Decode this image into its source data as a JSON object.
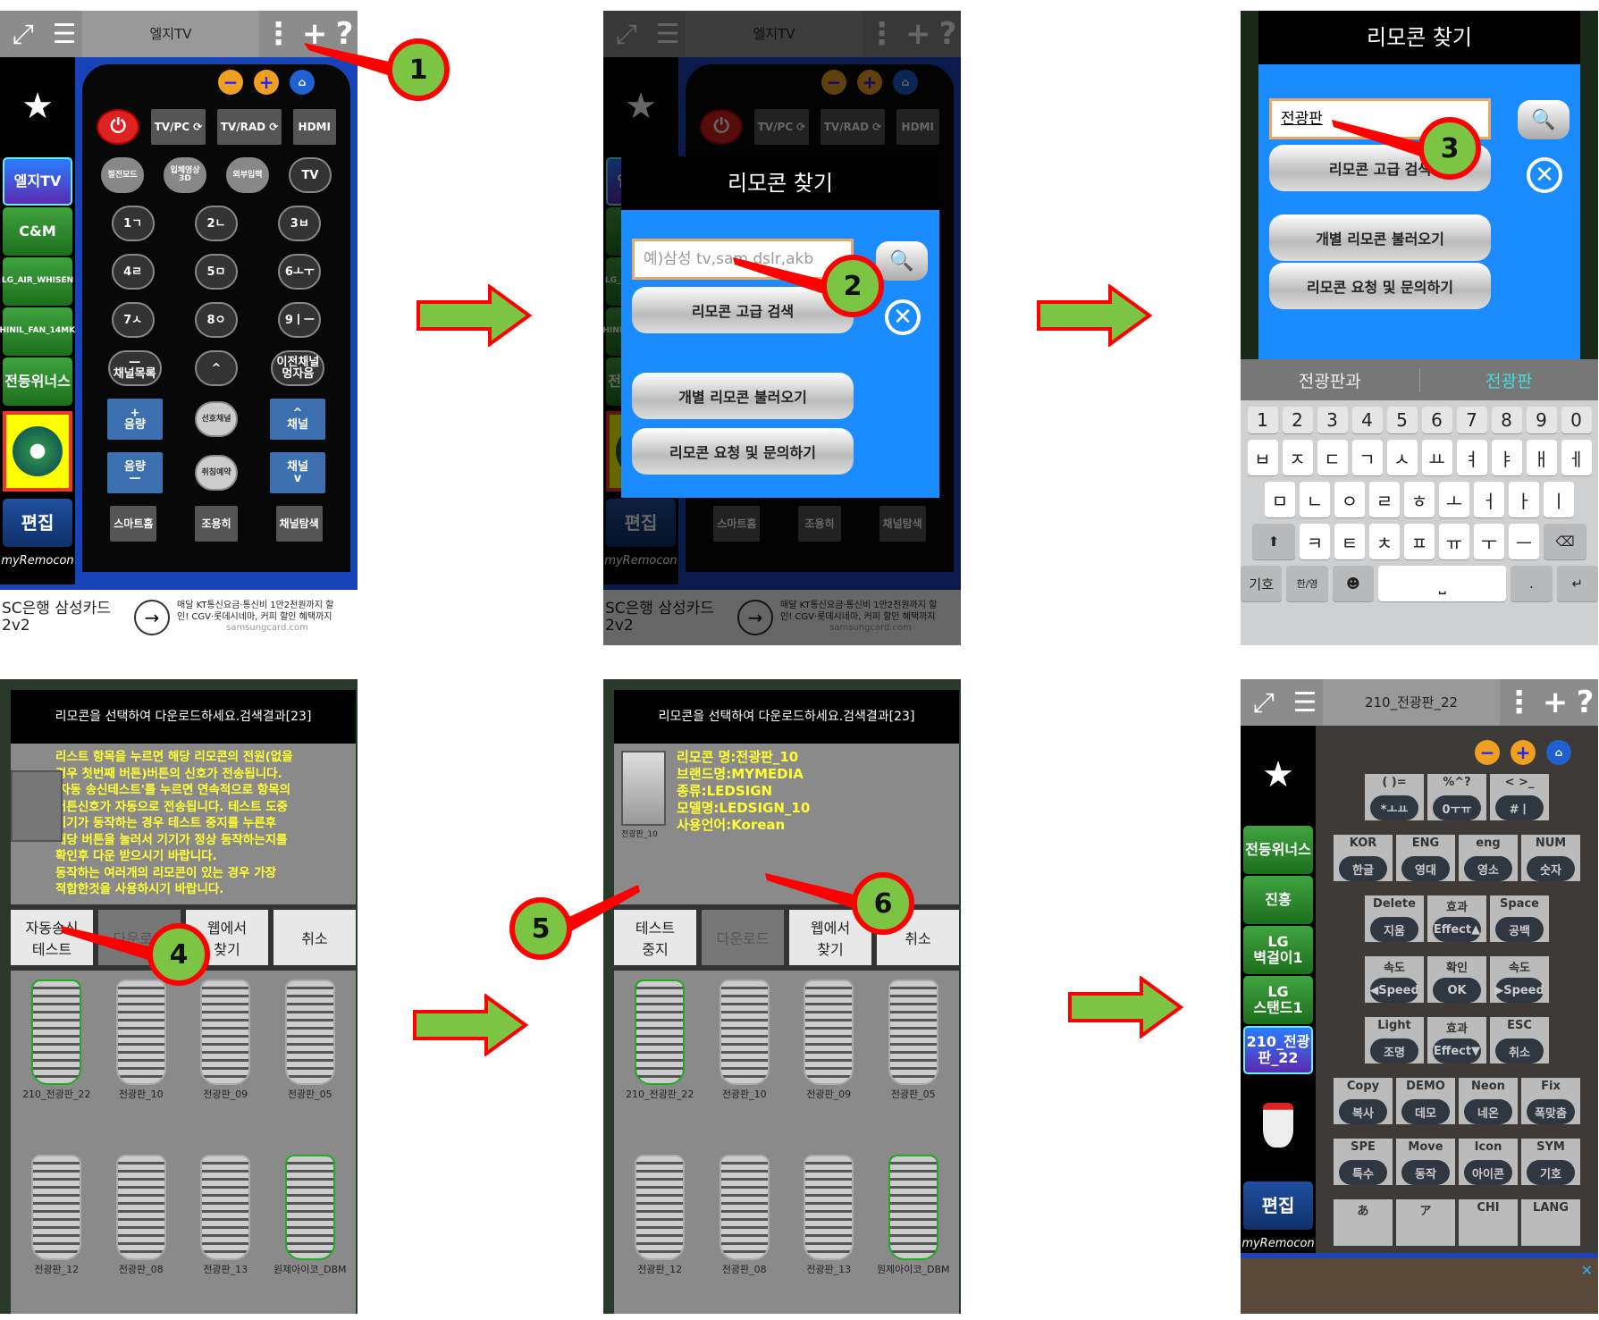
{
  "colors": {
    "accent_blue": "#1a8cff",
    "sidebar_green": "#2e8b2e",
    "callout_fill": "#7cc444",
    "callout_border": "#ff0000",
    "arrow_fill": "#7cc444",
    "hint_text": "#ffff33"
  },
  "icons": {
    "fullscreen": "expand-icon",
    "menu": "hamburger-icon",
    "more": "kebab-icon",
    "add": "plus-icon",
    "help": "question-icon",
    "favorite": "star-icon",
    "search": "magnifier-icon",
    "close": "close-circle-icon"
  },
  "remote1": {
    "title": "엘지TV",
    "sidebar": [
      "엘지TV",
      "C&M",
      "LG_AIR_WHISEN",
      "SHINIL_FAN_14MKR",
      "전등위너스"
    ],
    "edit": "편집",
    "logo": "myRemocon",
    "zoom_out": "−",
    "zoom_in": "+",
    "rows": [
      [
        {
          "t": "⏻",
          "c": "power"
        },
        {
          "t": "TV/PC ⟳",
          "c": "rect"
        },
        {
          "t": "TV/RAD ⟳",
          "c": "rect"
        },
        {
          "t": "HDMI",
          "c": "rect"
        }
      ],
      [
        {
          "t": "절전모드",
          "c": "gray"
        },
        {
          "t": "입체영상\n3D",
          "c": "gray"
        },
        {
          "t": "외부입력",
          "c": "gray"
        },
        {
          "t": "TV",
          "c": ""
        }
      ],
      [
        {
          "t": "1ㄱ"
        },
        {
          "t": "2ㄴ"
        },
        {
          "t": "3ㅂ"
        }
      ],
      [
        {
          "t": "4ㄹ"
        },
        {
          "t": "5ㅁ"
        },
        {
          "t": "6ㅗㅜ"
        }
      ],
      [
        {
          "t": "7ㅅ"
        },
        {
          "t": "8ㅇ"
        },
        {
          "t": "9ㅣㅡ"
        }
      ],
      [
        {
          "t": "—\n채널목록"
        },
        {
          "t": "^"
        },
        {
          "t": "이전채널\n멍자음"
        }
      ],
      [
        {
          "t": "+\n음량",
          "c": "blue"
        },
        {
          "t": "선호채널",
          "c": "pill"
        },
        {
          "t": "^\n채널",
          "c": "blue"
        }
      ],
      [
        {
          "t": "음량\n—",
          "c": "blue"
        },
        {
          "t": "취침예약",
          "c": "pill"
        },
        {
          "t": "채널\nv",
          "c": "blue"
        }
      ],
      [
        {
          "t": "스마트홈",
          "c": "rect"
        },
        {
          "t": "조용히",
          "c": "rect"
        },
        {
          "t": "채널탐색",
          "c": "rect"
        }
      ]
    ]
  },
  "ad1": {
    "left1": "SC은행 삼성카드",
    "left2": "2v2",
    "text1": "매달 KT통신요금·통신비 1만2천원까지 할",
    "text2": "인! CGV·롯데시네마, 커피 할인 혜택까지",
    "domain": "samsungcard.com"
  },
  "finder": {
    "title": "리모콘 찾기",
    "placeholder": "예)삼성 tv,sam,dslr,akb",
    "typed": "전광판",
    "advanced": "리모콘 고급 검색",
    "load": "개별 리모콘 불러오기",
    "request": "리모콘 요청 및 문의하기"
  },
  "keyboard": {
    "suggestions": [
      "전광판과",
      "전광판"
    ],
    "numbers": [
      "1",
      "2",
      "3",
      "4",
      "5",
      "6",
      "7",
      "8",
      "9",
      "0"
    ],
    "row1": [
      "ㅂ",
      "ㅈ",
      "ㄷ",
      "ㄱ",
      "ㅅ",
      "ㅛ",
      "ㅕ",
      "ㅑ",
      "ㅐ",
      "ㅔ"
    ],
    "row2": [
      "ㅁ",
      "ㄴ",
      "ㅇ",
      "ㄹ",
      "ㅎ",
      "ㅗ",
      "ㅓ",
      "ㅏ",
      "ㅣ"
    ],
    "row3": [
      "ㅋ",
      "ㅌ",
      "ㅊ",
      "ㅍ",
      "ㅠ",
      "ㅜ",
      "ㅡ"
    ],
    "shift": "⬆",
    "backspace": "⌫",
    "symbols": "기호",
    "lang": "한/영",
    "emoji": "☻",
    "space": "⎵",
    "period": ".",
    "enter": "↵"
  },
  "results": {
    "title": "리모콘을 선택하여 다운로드하세요.검색결과[23]",
    "hint": [
      "리스트 항목을 누르면 해당 리모콘의 전원(없을",
      "경우 첫번째 버튼)버튼의 신호가 전송됩니다.",
      "'자동 송신테스트'를 누르면 연속적으로 항목의",
      "버튼신호가 자동으로 전송됩니다. 테스트 도중",
      "기기가 동작하는 경우 테스트 중지를 누른후",
      "해당 버튼을 눌러서 기기가 정상 동작하는지를",
      "확인후 다운 받으시기 바랍니다.",
      "동작하는 여러개의 리모콘이 있는 경우 가장",
      "적합한것을 사용하시기 바랍니다."
    ],
    "buttons": [
      "자동송신\n테스트",
      "다운로드",
      "웹에서\n찾기",
      "취소"
    ],
    "buttons_testing": [
      "테스트\n중지",
      "다운로드",
      "웹에서\n찾기",
      "취소"
    ],
    "details": [
      "리모콘 명:전광판_10",
      "브랜드명:MYMEDIA",
      "종류:LEDSIGN",
      "모델명:LEDSIGN_10",
      "사용언어:Korean"
    ],
    "detail_thumb": "전광판_10",
    "items": [
      "210_전광판_22",
      "전광판_10",
      "전광판_09",
      "전광판_05",
      "전광판_12",
      "전광판_08",
      "전광판_13",
      "원제아이코_DBM"
    ]
  },
  "remote2": {
    "title": "210_전광판_22",
    "sidebar": [
      "전등위너스",
      "진흥",
      "LG\n벽걸이1",
      "LG\n스탠드1",
      "210_전광판_22"
    ],
    "edit": "편집",
    "logo": "myRemocon",
    "rows": [
      [
        {
          "t": "( )=",
          "b": "*ㅗㅛ"
        },
        {
          "t": "%^?",
          "b": "0ㅜㅠ"
        },
        {
          "t": "< >_",
          "b": "#ㅣ"
        }
      ],
      [
        {
          "t": "KOR",
          "b": "한글"
        },
        {
          "t": "ENG",
          "b": "영대"
        },
        {
          "t": "eng",
          "b": "영소"
        },
        {
          "t": "NUM",
          "b": "숫자"
        }
      ],
      [
        {
          "t": "Delete",
          "b": "지움"
        },
        {
          "t": "효과",
          "b": "Effect▲"
        },
        {
          "t": "Space",
          "b": "공백"
        }
      ],
      [
        {
          "t": "속도",
          "b": "◀Speed"
        },
        {
          "t": "확인",
          "b": "OK"
        },
        {
          "t": "속도",
          "b": "▶Speed"
        }
      ],
      [
        {
          "t": "Light",
          "b": "조명"
        },
        {
          "t": "효과",
          "b": "Effect▼"
        },
        {
          "t": "ESC",
          "b": "취소"
        }
      ],
      [
        {
          "t": "Copy",
          "b": "복사"
        },
        {
          "t": "DEMO",
          "b": "데모"
        },
        {
          "t": "Neon",
          "b": "네온"
        },
        {
          "t": "Fix",
          "b": "폭맞춤"
        }
      ],
      [
        {
          "t": "SPE",
          "b": "특수"
        },
        {
          "t": "Move",
          "b": "동작"
        },
        {
          "t": "Icon",
          "b": "아이콘"
        },
        {
          "t": "SYM",
          "b": "기호"
        }
      ],
      [
        {
          "t": "あ",
          "b": ""
        },
        {
          "t": "ア",
          "b": ""
        },
        {
          "t": "CHI",
          "b": ""
        },
        {
          "t": "LANG",
          "b": ""
        }
      ]
    ]
  },
  "steps": [
    "1",
    "2",
    "3",
    "4",
    "5",
    "6"
  ]
}
